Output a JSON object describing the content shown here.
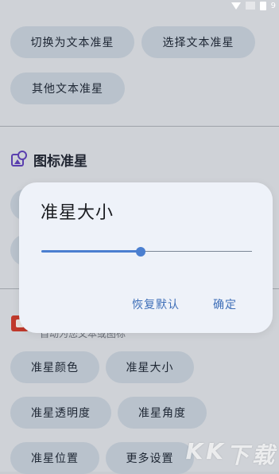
{
  "status_bar": {
    "icons": [
      "wifi-icon",
      "signal-icon",
      "battery-icon"
    ],
    "time_fragment": "9"
  },
  "top_chips": [
    "切换为文本准星",
    "选择文本准星",
    "其他文本准星"
  ],
  "section_icon_title": "图标准星",
  "section_text_title": "自动为您文本或图标",
  "bottom_chips": [
    "准星颜色",
    "准星大小",
    "准星透明度",
    "准星角度",
    "准星位置",
    "更多设置"
  ],
  "dialog": {
    "title": "准星大小",
    "slider_value_fraction": 0.47,
    "reset_label": "恢复默认",
    "confirm_label": "确定"
  },
  "colors": {
    "accent": "#4b7fd0",
    "dialog_bg": "#eef2f9",
    "chip_bg": "#b9c2cc",
    "scrim": "#cfd2d7"
  },
  "watermark": "KK下载"
}
